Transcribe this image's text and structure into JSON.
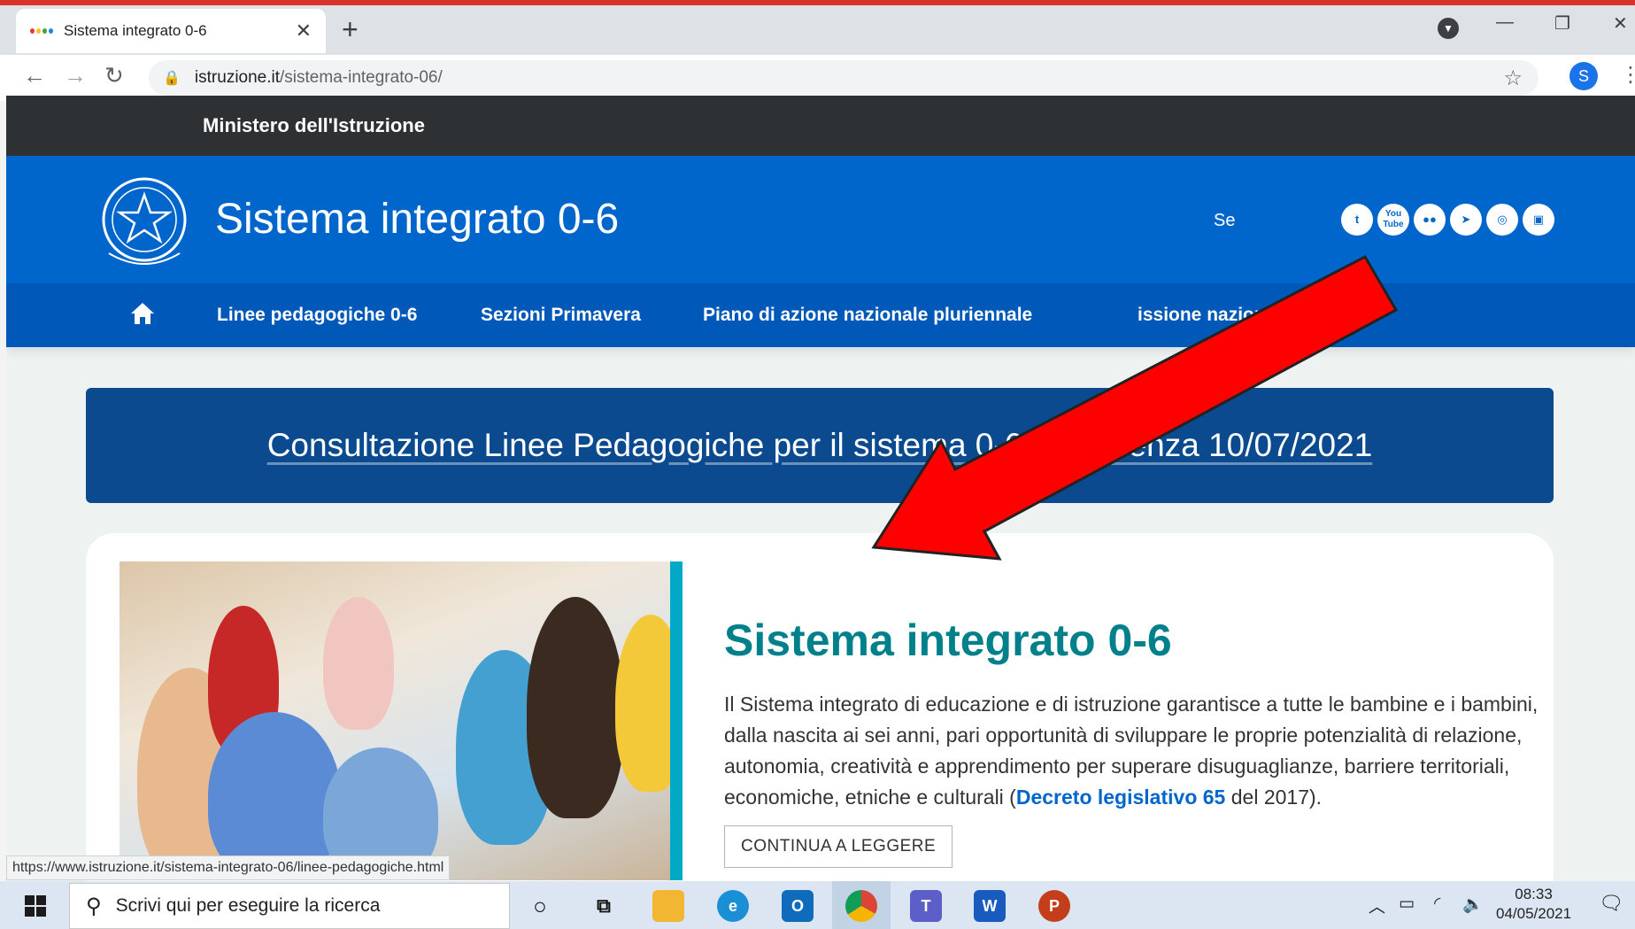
{
  "browser": {
    "tab_title": "Sistema integrato 0-6",
    "new_tab": "+",
    "url_host": "istruzione.it",
    "url_path": "/sistema-integrato-06/",
    "profile_initial": "S"
  },
  "site": {
    "ministry": "Ministero dell'Istruzione",
    "title": "Sistema integrato 0-6",
    "social_label": "Se",
    "social_icons": [
      "twitter-icon",
      "youtube-icon",
      "flickr-icon",
      "telegram-icon",
      "instagram-icon",
      "slideshare-icon"
    ],
    "youtube_text": "You Tube",
    "nav": {
      "item1": "Linee pedagogiche 0-6",
      "item2": "Sezioni Primavera",
      "item3": "Piano di azione nazionale pluriennale",
      "item4": "issione nazionale 0-6"
    },
    "banner_link": "Consultazione Linee Pedagogiche per il sistema 0-6 – scadenza 10/07/2021",
    "card": {
      "title": "Sistema integrato 0-6",
      "text_before": "Il Sistema integrato di educazione e di istruzione garantisce a tutte le bambine e i bambini, dalla nascita ai sei anni, pari opportunità di sviluppare le proprie potenzialità di relazione, autonomia, creatività e apprendimento per superare disuguaglianze, barriere territoriali, economiche, etniche e culturali (",
      "link": "Decreto legislativo 65",
      "text_after": " del 2017).",
      "button": "CONTINUA A LEGGERE"
    },
    "status_url": "https://www.istruzione.it/sistema-integrato-06/linee-pedagogiche.html"
  },
  "taskbar": {
    "search_placeholder": "Scrivi qui per eseguire la ricerca",
    "time": "08:33",
    "date": "04/05/2021",
    "apps": [
      "cortana-icon",
      "task-view-icon",
      "file-explorer-icon",
      "edge-icon",
      "outlook-icon",
      "chrome-icon",
      "teams-icon",
      "word-icon",
      "powerpoint-icon"
    ]
  },
  "colors": {
    "header_blue": "#0066cc",
    "nav_blue": "#0058b8",
    "banner_blue": "#0b4a8f",
    "title_teal": "#00808a",
    "arrow_red": "#ff0000"
  }
}
